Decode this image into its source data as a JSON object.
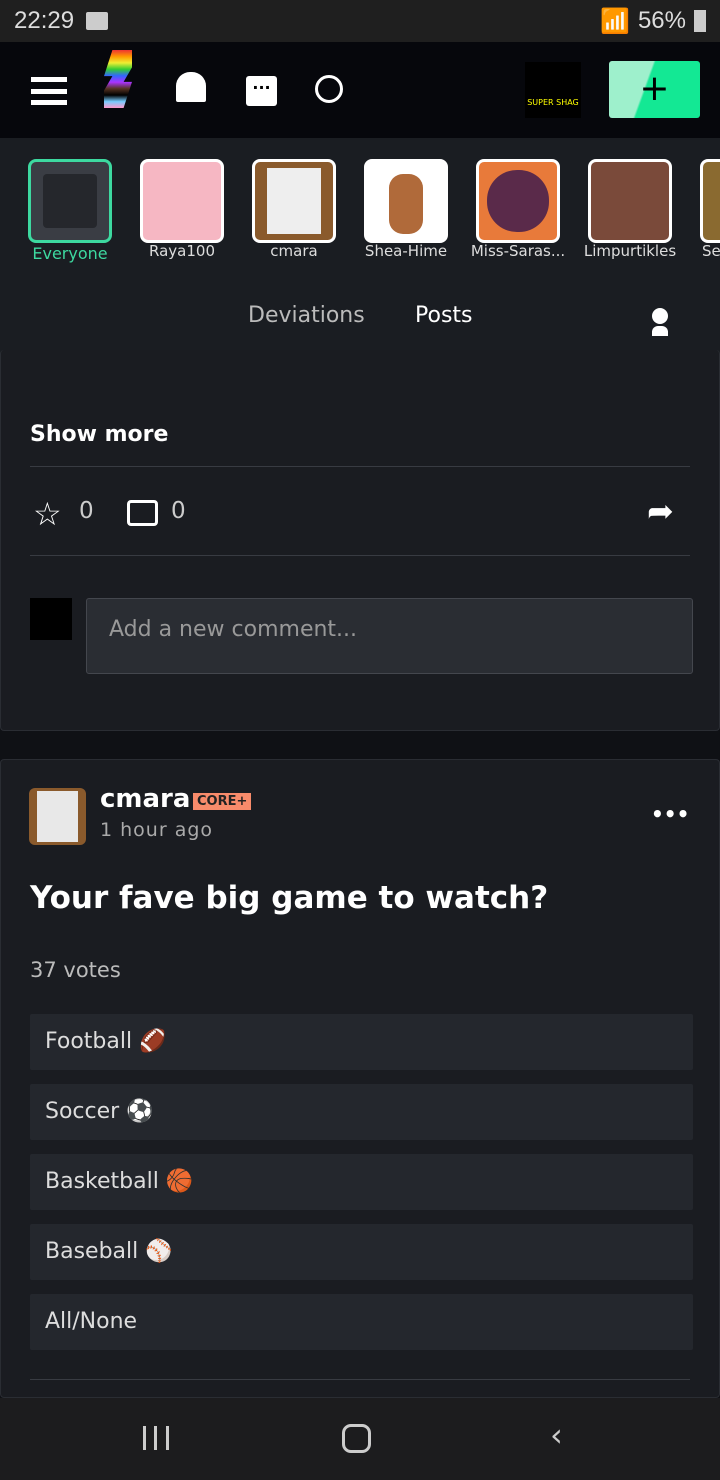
{
  "status": {
    "time": "22:29",
    "battery": "56%"
  },
  "nav": {
    "create_label": "+",
    "user_avatar": "SUPER SHAG"
  },
  "friends": [
    {
      "label": "Everyone",
      "color": "#3dd9a0"
    },
    {
      "label": "Raya100"
    },
    {
      "label": "cmara"
    },
    {
      "label": "Shea-Hime"
    },
    {
      "label": "Miss-Saras..."
    },
    {
      "label": "Limpurtikles"
    },
    {
      "label": "Se"
    }
  ],
  "tabs": {
    "deviations": "Deviations",
    "posts": "Posts",
    "active": "Posts"
  },
  "prev_post": {
    "show_more": "Show more",
    "favorites": "0",
    "comments": "0",
    "comment_placeholder": "Add a new comment..."
  },
  "post": {
    "author": "cmara",
    "badge": "CORE+",
    "time": "1 hour ago",
    "title": "Your fave big game to watch?",
    "votes": "37 votes",
    "options": [
      "Football 🏈",
      "Soccer ⚽",
      "Basketball 🏀",
      "Baseball ⚾",
      "All/None"
    ]
  },
  "colors": {
    "accent": "#00e59b",
    "badge": "#f88b6b"
  }
}
